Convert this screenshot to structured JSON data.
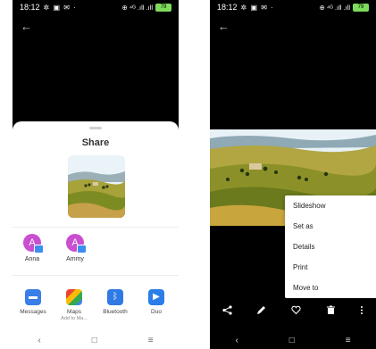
{
  "status": {
    "time": "18:12",
    "icons": "✲ ▣ ✉ ·",
    "signal": "⊕ ⁴ᴳ .ıll .ıll",
    "battery": "79"
  },
  "left": {
    "share_title": "Share",
    "contacts": [
      {
        "initial": "A",
        "name": "Anna"
      },
      {
        "initial": "A",
        "name": "Ammy"
      }
    ],
    "apps": [
      {
        "label": "Messages",
        "sublabel": "",
        "icon": "message-icon",
        "color": "#3a7ee8",
        "glyph": "▬"
      },
      {
        "label": "Maps",
        "sublabel": "Add to Ma...",
        "icon": "maps-icon",
        "color": "#34a853",
        "glyph": "◆"
      },
      {
        "label": "Bluetooth",
        "sublabel": "",
        "icon": "bluetooth-icon",
        "color": "#2f7ae5",
        "glyph": "✱"
      },
      {
        "label": "Duo",
        "sublabel": "",
        "icon": "video-icon",
        "color": "#2b7de9",
        "glyph": "■"
      }
    ],
    "nav": {
      "back": "‹",
      "home": "□",
      "recents": "≡"
    }
  },
  "right": {
    "menu_items": [
      "Slideshow",
      "Set as",
      "Details",
      "Print",
      "Move to"
    ],
    "toolbar": {
      "share": "share-icon",
      "edit": "edit-icon",
      "favorite": "heart-icon",
      "delete": "trash-icon",
      "more": "more-icon"
    },
    "nav": {
      "back": "‹",
      "home": "□",
      "recents": "≡"
    }
  },
  "colors": {
    "avatar": "#c94fd0",
    "sheet": "#ffffff",
    "background": "#000000"
  }
}
